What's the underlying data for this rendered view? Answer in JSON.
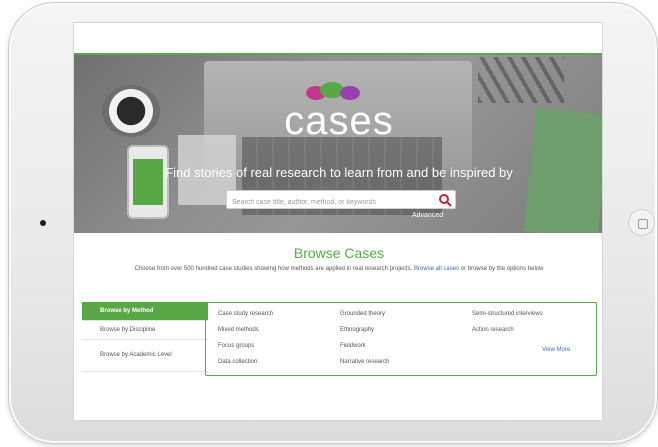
{
  "hero": {
    "brand": "cases",
    "tagline": "Find stories of real research to learn from and be inspired by",
    "search_placeholder": "Search case title, author, method, or keywords",
    "advanced_label": "Advanced"
  },
  "browse": {
    "title": "Browse Cases",
    "desc_prefix": "Choose from over 500 hundred case studies showing how methods are applied in real research projects.",
    "desc_link": "Browse all cases",
    "desc_suffix": "or browse by the options below"
  },
  "tabs": [
    {
      "label": "Browse by Method",
      "active": true
    },
    {
      "label": "Browse by Discipline",
      "active": false
    },
    {
      "label": "Browse by Academic Level",
      "active": false
    }
  ],
  "methods": {
    "col1": [
      "Case study research",
      "Mixed methods",
      "Focus groups",
      "Data collection"
    ],
    "col2": [
      "Grounded theory",
      "Ethnography",
      "Fieldwork",
      "Narrative research"
    ],
    "col3": [
      "Semi-structured interviews",
      "Action research"
    ],
    "view_more": "View More"
  },
  "colors": {
    "accent": "#58a847",
    "link": "#3a70c2",
    "logo_pink": "#c0398a",
    "logo_purple": "#9a3fb0"
  }
}
